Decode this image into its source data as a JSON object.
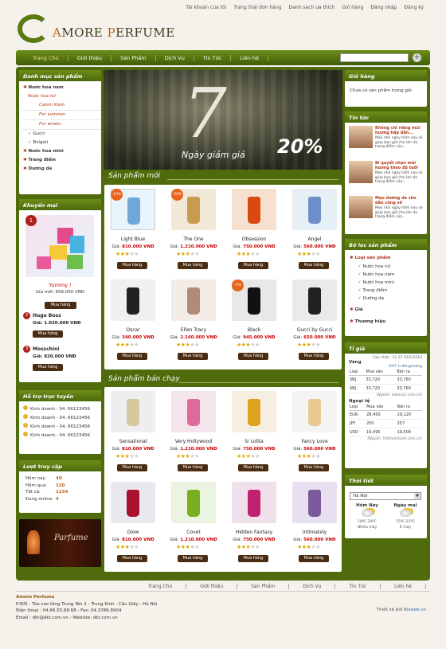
{
  "top_links": [
    "Tài khoản của tôi",
    "Trạng thái đơn hàng",
    "Danh sách ưa thích",
    "Giỏ hàng",
    "Đăng nhập",
    "Đăng ký"
  ],
  "logo": {
    "pre": "A",
    "mid": "MORE ",
    "p": "P",
    "post": "ERFUME"
  },
  "nav": [
    "Trang Chủ",
    "Giới thiệu",
    "Sản Phẩm",
    "Dịch Vụ",
    "Tin Tức",
    "Liên hệ"
  ],
  "left": {
    "cat_title": "Danh mục sản phẩm",
    "cats": [
      {
        "t": "Nước hoa nam",
        "c": "lv1"
      },
      {
        "t": "Nước hoa nữ",
        "c": "lv2"
      },
      {
        "t": "Calvin Klein",
        "c": "lv3"
      },
      {
        "t": "For summer",
        "c": "lv3"
      },
      {
        "t": "For winter",
        "c": "lv3"
      },
      {
        "t": "Gucci",
        "c": "lv2b"
      },
      {
        "t": "Bvlgari",
        "c": "lv2b"
      },
      {
        "t": "Nước hoa mini",
        "c": "lv1"
      },
      {
        "t": "Trang điểm",
        "c": "lv1"
      },
      {
        "t": "Dưỡng da",
        "c": "lv1"
      }
    ],
    "promo_title": "Khuyến mại",
    "promo": {
      "name": "Yummy !",
      "price": "Giá mới: 699.000 VNĐ",
      "btn": "Mua hàng",
      "items": [
        {
          "n": "2",
          "name": "Hugo Boss",
          "price": "Giá: 1.020.000 VNĐ",
          "btn": "Mua hàng"
        },
        {
          "n": "3",
          "name": "Mosschini",
          "price": "Giá: 820.000 VNĐ",
          "btn": "Mua hàng"
        }
      ]
    },
    "support_title": "Hỗ trợ trực tuyến",
    "support": [
      "Kinh doanh - 04. 66123456",
      "Kinh doanh - 04. 66123456",
      "Kinh doanh - 04. 66123456",
      "Kinh doanh - 04. 66123456"
    ],
    "visit_title": "Lượt truy cập",
    "visits": [
      {
        "k": "Hôm nay:",
        "v": "40"
      },
      {
        "k": "Hôm qua:",
        "v": "120"
      },
      {
        "k": "Tất cả:",
        "v": "1234"
      },
      {
        "k": "Đang online:",
        "v": "4"
      }
    ],
    "banner_text": "Parfume"
  },
  "hero": {
    "big": "7",
    "text": "Ngày giảm giá",
    "pct": "20%"
  },
  "new_title": "Sản phẩm mới",
  "best_title": "Sản phẩm bán chạy",
  "products_new": [
    {
      "name": "Light Blue",
      "price": "810.000 VNĐ",
      "stars": 3,
      "badge": "-10%"
    },
    {
      "name": "The One",
      "price": "1.210.000 VNĐ",
      "stars": 3,
      "badge": "-20%"
    },
    {
      "name": "Obsession",
      "price": "750.000 VNĐ",
      "stars": 3,
      "badge": ""
    },
    {
      "name": "Angel",
      "price": "560.000 VNĐ",
      "stars": 3,
      "badge": ""
    },
    {
      "name": "Oscar",
      "price": "340.000 VNĐ",
      "stars": 3,
      "badge": ""
    },
    {
      "name": "Ellen Tracy",
      "price": "2.160.000 VNĐ",
      "stars": 3,
      "badge": ""
    },
    {
      "name": "Black",
      "price": "945.000 VNĐ",
      "stars": 3,
      "badge": "-5%"
    },
    {
      "name": "Gucci by Gucci",
      "price": "650.000 VNĐ",
      "stars": 3,
      "badge": ""
    }
  ],
  "products_best": [
    {
      "name": "Sensational",
      "price": "810.000 VNĐ",
      "stars": 3
    },
    {
      "name": "Very Hollywood",
      "price": "1.210.000 VNĐ",
      "stars": 3
    },
    {
      "name": "Si Lolita",
      "price": "750.000 VNĐ",
      "stars": 3
    },
    {
      "name": "Fancy Love",
      "price": "560.000 VNĐ",
      "stars": 3
    },
    {
      "name": "Glow",
      "price": "810.000 VNĐ",
      "stars": 3
    },
    {
      "name": "Covet",
      "price": "1.210.000 VNĐ",
      "stars": 3
    },
    {
      "name": "Hidden Fantasy",
      "price": "750.000 VNĐ",
      "stars": 3
    },
    {
      "name": "Intimately",
      "price": "560.000 VNĐ",
      "stars": 3
    }
  ],
  "price_prefix": "Giá: ",
  "buy_label": "Mua hàng",
  "right": {
    "cart_title": "Giỏ hàng",
    "cart_text": "Chưa có sản phẩm trong giỏ",
    "news_title": "Tin tức",
    "news": [
      {
        "t": "Không chỉ riêng mùi hương hấp dẫn...",
        "d": "Mẹo nhỏ ngày hôm nay sẽ giúp bạn giữ cho làn da trang điểm của..."
      },
      {
        "t": "Bí quyết chọn mùi hương theo độ tuổi",
        "d": "Mẹo nhỏ ngày hôm nay sẽ giúp bạn giữ cho làn da trang điểm của..."
      },
      {
        "t": "Mẹo dưỡng da cho dân công sở",
        "d": "Mẹo nhỏ ngày hôm nay sẽ giúp bạn giữ cho làn da trang điểm của..."
      }
    ],
    "filter_title": "Bộ lọc sản phẩm",
    "filter_head": "Loại sản phẩm",
    "filter_items": [
      "Nước hoa nữ",
      "Nước hoa nam",
      "Nước hoa mini",
      "Trang điểm",
      "Dưỡng da"
    ],
    "filter_other": [
      "Giá",
      "Thương hiệu"
    ],
    "rate_title": "Tỉ giá",
    "rate_date": "Cập nhật : 11:25 03/1/2010",
    "gold_title": "Vàng",
    "gold_unit": "ĐVT: tr.đồng/lượng",
    "gold_head": [
      "Loại",
      "Mua vào",
      "Bán ra"
    ],
    "gold_rows": [
      [
        "SBJ",
        "33,720",
        "33,760"
      ],
      [
        "SBJ",
        "33,720",
        "33,760"
      ]
    ],
    "gold_src": "(Nguồn: www.sjc.com.vn)",
    "fx_title": "Ngoại tệ",
    "fx_head": [
      "Loại",
      "Mua vào",
      "Bán ra"
    ],
    "fx_rows": [
      [
        "EUR",
        "28,450",
        "29,120"
      ],
      [
        "JPY",
        "250",
        "257"
      ],
      [
        "USD",
        "19,495",
        "19,500"
      ]
    ],
    "fx_src": "(Nguồn: Vietcombank.com.vn)",
    "weather_title": "Thời tiết",
    "city": "Hà Nội",
    "w": [
      {
        "day": "Hôm Nay",
        "temp": "18ºC-29ºC",
        "desc": "Nhiều mây"
      },
      {
        "day": "Ngày mai",
        "temp": "15ºC-22ºC",
        "desc": "Ít mây"
      }
    ]
  },
  "foot_links": [
    "Trang Chủ",
    "Giới thiệu",
    "Sản Phẩm",
    "Dịch Vụ",
    "Tin Tức",
    "Liên hệ"
  ],
  "footer": {
    "name": "Amore Perfume",
    "addr": "P.905 - Tòa cao tầng Trung Yên 1 - Trung Kính - Cầu Giấy - Hà Nội",
    "phone": "Điện thoại : 04.66.55.88.68 - Fax: 04.3786.8904",
    "email": "Email : dkt@dkt.com.vn  -  Website: dkt.com.vn",
    "design": "Thiết kế bởi ",
    "design_link": "Bizweb.vn"
  }
}
